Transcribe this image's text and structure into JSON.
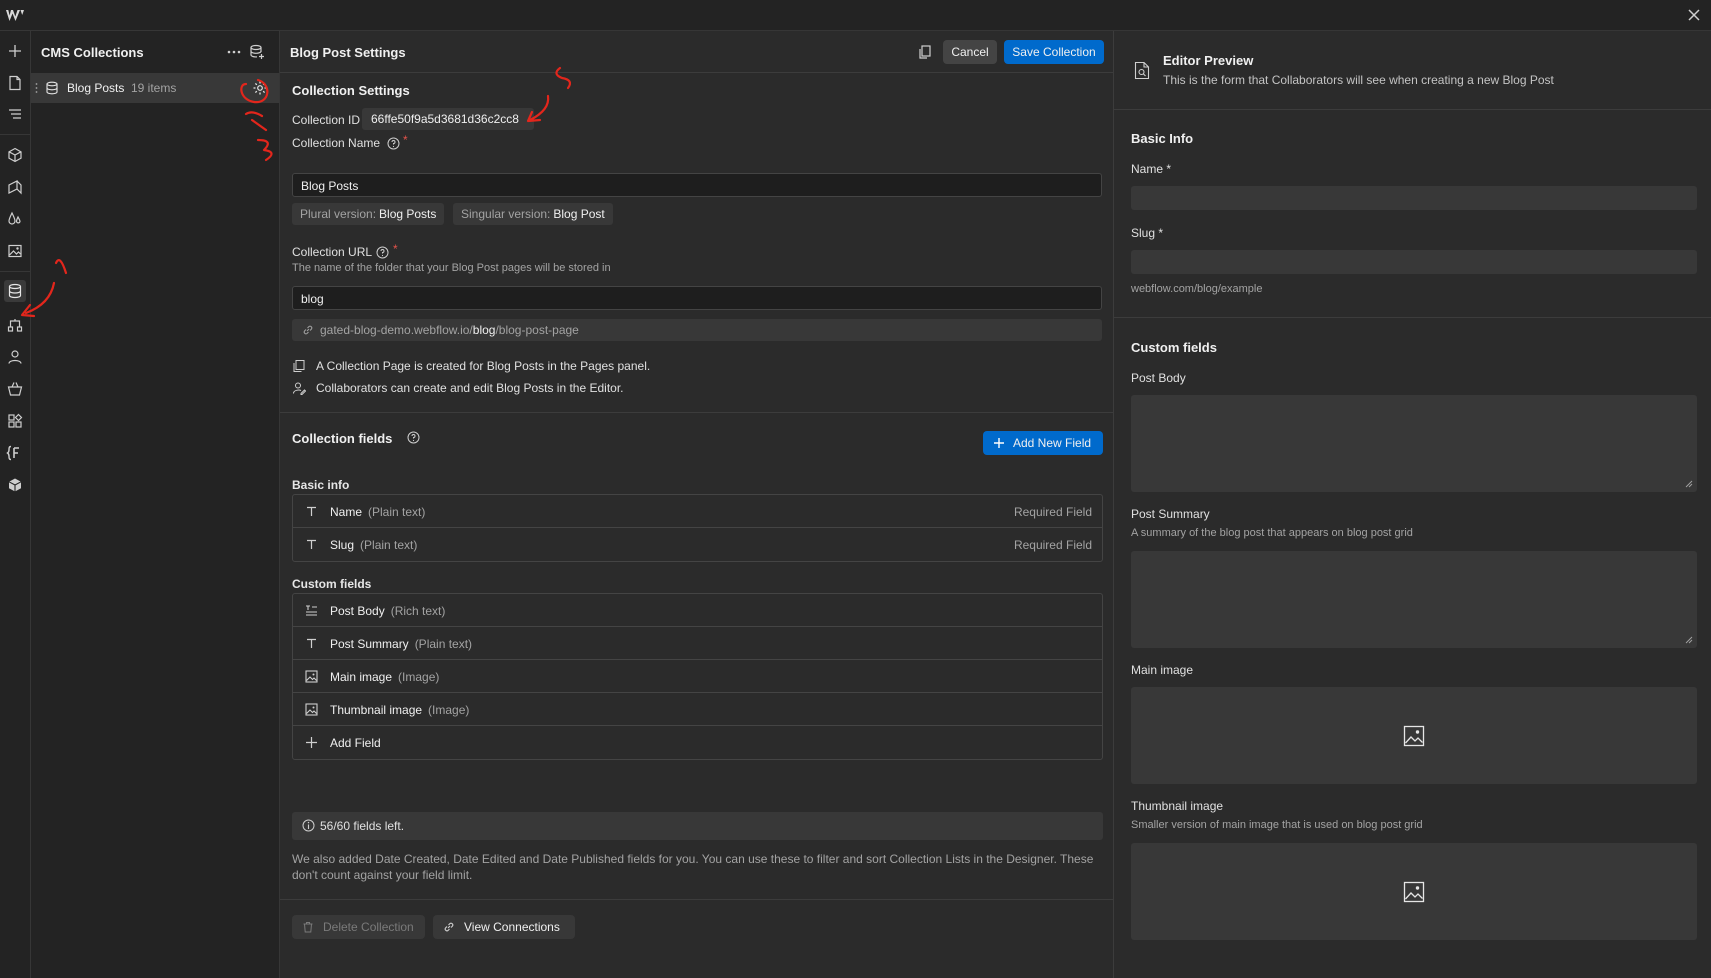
{
  "colors": {
    "accent": "#006acc",
    "annotation": "#e3261c",
    "required": "#e5534b"
  },
  "left_panel": {
    "title": "CMS Collections",
    "collection": {
      "name": "Blog Posts",
      "count": "19 items"
    }
  },
  "settings": {
    "title": "Blog Post Settings",
    "cancel_label": "Cancel",
    "save_label": "Save Collection",
    "section_title": "Collection Settings",
    "id_label": "Collection ID",
    "id_value": "66ffe50f9a5d3681d36c2cc8",
    "name_label": "Collection Name",
    "name_value": "Blog Posts",
    "plural_label": "Plural version:",
    "plural_value": "Blog Posts",
    "singular_label": "Singular version:",
    "singular_value": "Blog Post",
    "url_label": "Collection URL",
    "url_help": "The name of the folder that your Blog Post pages will be stored in",
    "url_value": "blog",
    "url_preview": {
      "prefix": "gated-blog-demo.webflow.io/",
      "folder": "blog",
      "suffix": "/blog-post-page"
    },
    "info_pages": "A Collection Page is created for Blog Posts in the Pages panel.",
    "info_editor": "Collaborators can create and edit Blog Posts in the Editor."
  },
  "fields": {
    "title": "Collection fields",
    "add_new_label": "Add New Field",
    "basic_title": "Basic info",
    "basic": [
      {
        "name": "Name",
        "type": "(Plain text)",
        "status": "Required Field",
        "icon": "text-icon"
      },
      {
        "name": "Slug",
        "type": "(Plain text)",
        "status": "Required Field",
        "icon": "text-icon"
      }
    ],
    "custom_title": "Custom fields",
    "custom": [
      {
        "name": "Post Body",
        "type": "(Rich text)",
        "icon": "rich-text-icon"
      },
      {
        "name": "Post Summary",
        "type": "(Plain text)",
        "icon": "text-icon"
      },
      {
        "name": "Main image",
        "type": "(Image)",
        "icon": "image-icon"
      },
      {
        "name": "Thumbnail image",
        "type": "(Image)",
        "icon": "image-icon"
      }
    ],
    "add_field_label": "Add Field",
    "fields_left": "56/60 fields left.",
    "note": "We also added Date Created, Date Edited and Date Published fields for you. You can use these to filter and sort Collection Lists in the Designer. These don't count against your field limit.",
    "delete_label": "Delete Collection",
    "connections_label": "View Connections"
  },
  "preview": {
    "title": "Editor Preview",
    "subtitle": "This is the form that Collaborators will see when creating a new Blog Post",
    "basic_title": "Basic Info",
    "name_label": "Name *",
    "slug_label": "Slug *",
    "slug_hint": "webflow.com/blog/example",
    "custom_title": "Custom fields",
    "post_body_label": "Post Body",
    "post_summary_label": "Post Summary",
    "post_summary_help": "A summary of the blog post that appears on blog post grid",
    "main_image_label": "Main image",
    "thumb_label": "Thumbnail image",
    "thumb_help": "Smaller version of main image that is used on blog post grid"
  }
}
